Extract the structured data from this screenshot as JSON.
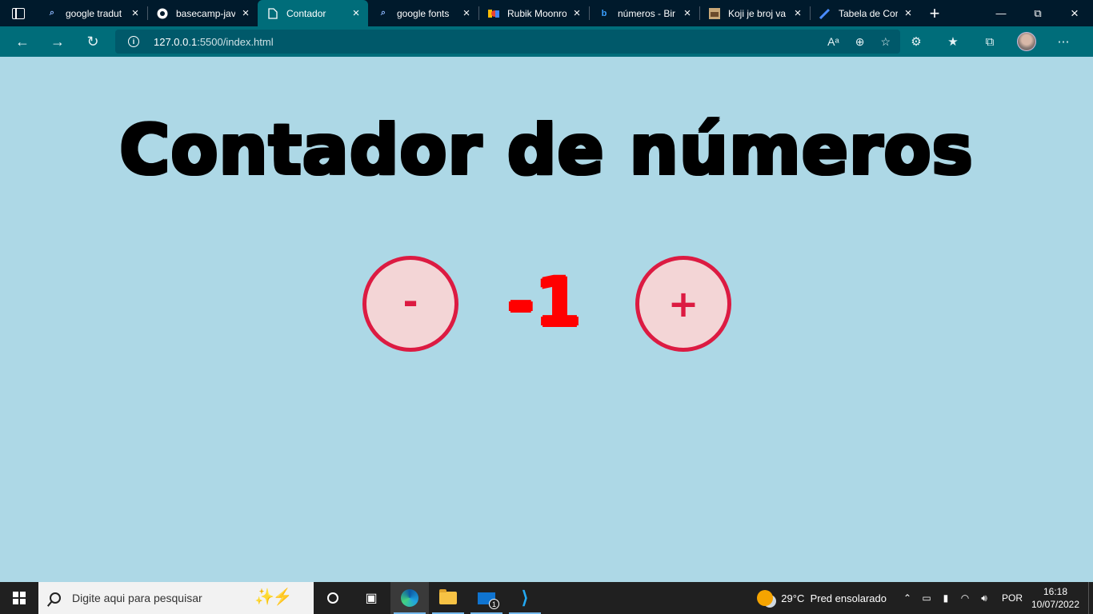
{
  "browser": {
    "tabs": [
      {
        "label": "google tradut",
        "icon": "search-icon",
        "active": false
      },
      {
        "label": "basecamp-jav",
        "icon": "github-icon",
        "active": false
      },
      {
        "label": "Contador",
        "icon": "page-icon",
        "active": true
      },
      {
        "label": "google fonts",
        "icon": "search-icon",
        "active": false
      },
      {
        "label": "Rubik Moonro",
        "icon": "google-fonts-icon",
        "active": false
      },
      {
        "label": "números - Bir",
        "icon": "bing-icon",
        "active": false
      },
      {
        "label": "Koji je broj va",
        "icon": "image-icon",
        "active": false
      },
      {
        "label": "Tabela de Cor",
        "icon": "pen-icon",
        "active": false
      }
    ],
    "address": {
      "host": "127.0.0.1",
      "path": ":5500/index.html"
    }
  },
  "page": {
    "title": "Contador de números",
    "counter_value": "-1",
    "decrement_label": "-",
    "increment_label": "+"
  },
  "taskbar": {
    "search_placeholder": "Digite aqui para pesquisar",
    "weather_temp": "29°C",
    "weather_desc": "Pred ensolarado",
    "language": "POR",
    "time": "16:18",
    "date": "10/07/2022",
    "mail_badge": "1"
  },
  "colors": {
    "page_background": "#add8e6",
    "button_border": "#dc1b42",
    "button_fill": "#f3d5d6",
    "counter_color": "#ff0000",
    "title_color": "#000000"
  }
}
